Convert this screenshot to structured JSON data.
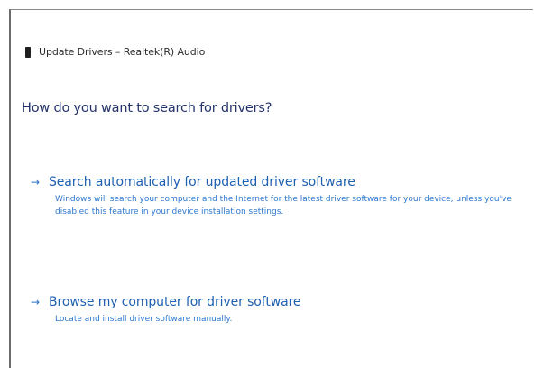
{
  "window": {
    "title": "Update Drivers – Realtek(R) Audio",
    "icon": "device-icon"
  },
  "heading": "How do you want to search for drivers?",
  "options": [
    {
      "icon": "arrow-right-icon",
      "arrow": "→",
      "title": "Search automatically for updated driver software",
      "description": "Windows will search your computer and the Internet for the latest driver software for your device, unless you've disabled this feature in your device installation settings."
    },
    {
      "icon": "arrow-right-icon",
      "arrow": "→",
      "title": "Browse my computer for driver software",
      "description": "Locate and install driver software manually."
    }
  ],
  "colors": {
    "heading": "#24336b",
    "link_title": "#1f5fb0",
    "link_description": "#2d78cf"
  }
}
